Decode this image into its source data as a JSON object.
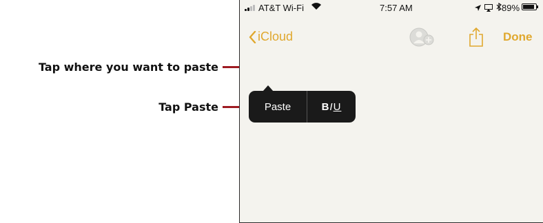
{
  "callouts": {
    "tap_location": "Tap where you want to paste",
    "tap_paste": "Tap Paste"
  },
  "status_bar": {
    "carrier": "AT&T Wi-Fi",
    "time": "7:57 AM",
    "battery_percent": "89%",
    "battery_level": 0.89
  },
  "nav": {
    "back_label": "iCloud",
    "done_label": "Done"
  },
  "edit_menu": {
    "paste_label": "Paste",
    "format": {
      "bold": "B",
      "italic": "I",
      "underline": "U"
    }
  },
  "colors": {
    "accent": "#e0a82e",
    "callout_line": "#9e1b22",
    "note_bg": "#f4f3ee",
    "menu_bg": "#1a1a1a"
  },
  "icons": [
    "signal-icon",
    "wifi-icon",
    "location-icon",
    "airplay-icon",
    "bluetooth-icon",
    "battery-icon",
    "back-chevron-icon",
    "add-person-icon",
    "share-icon"
  ]
}
